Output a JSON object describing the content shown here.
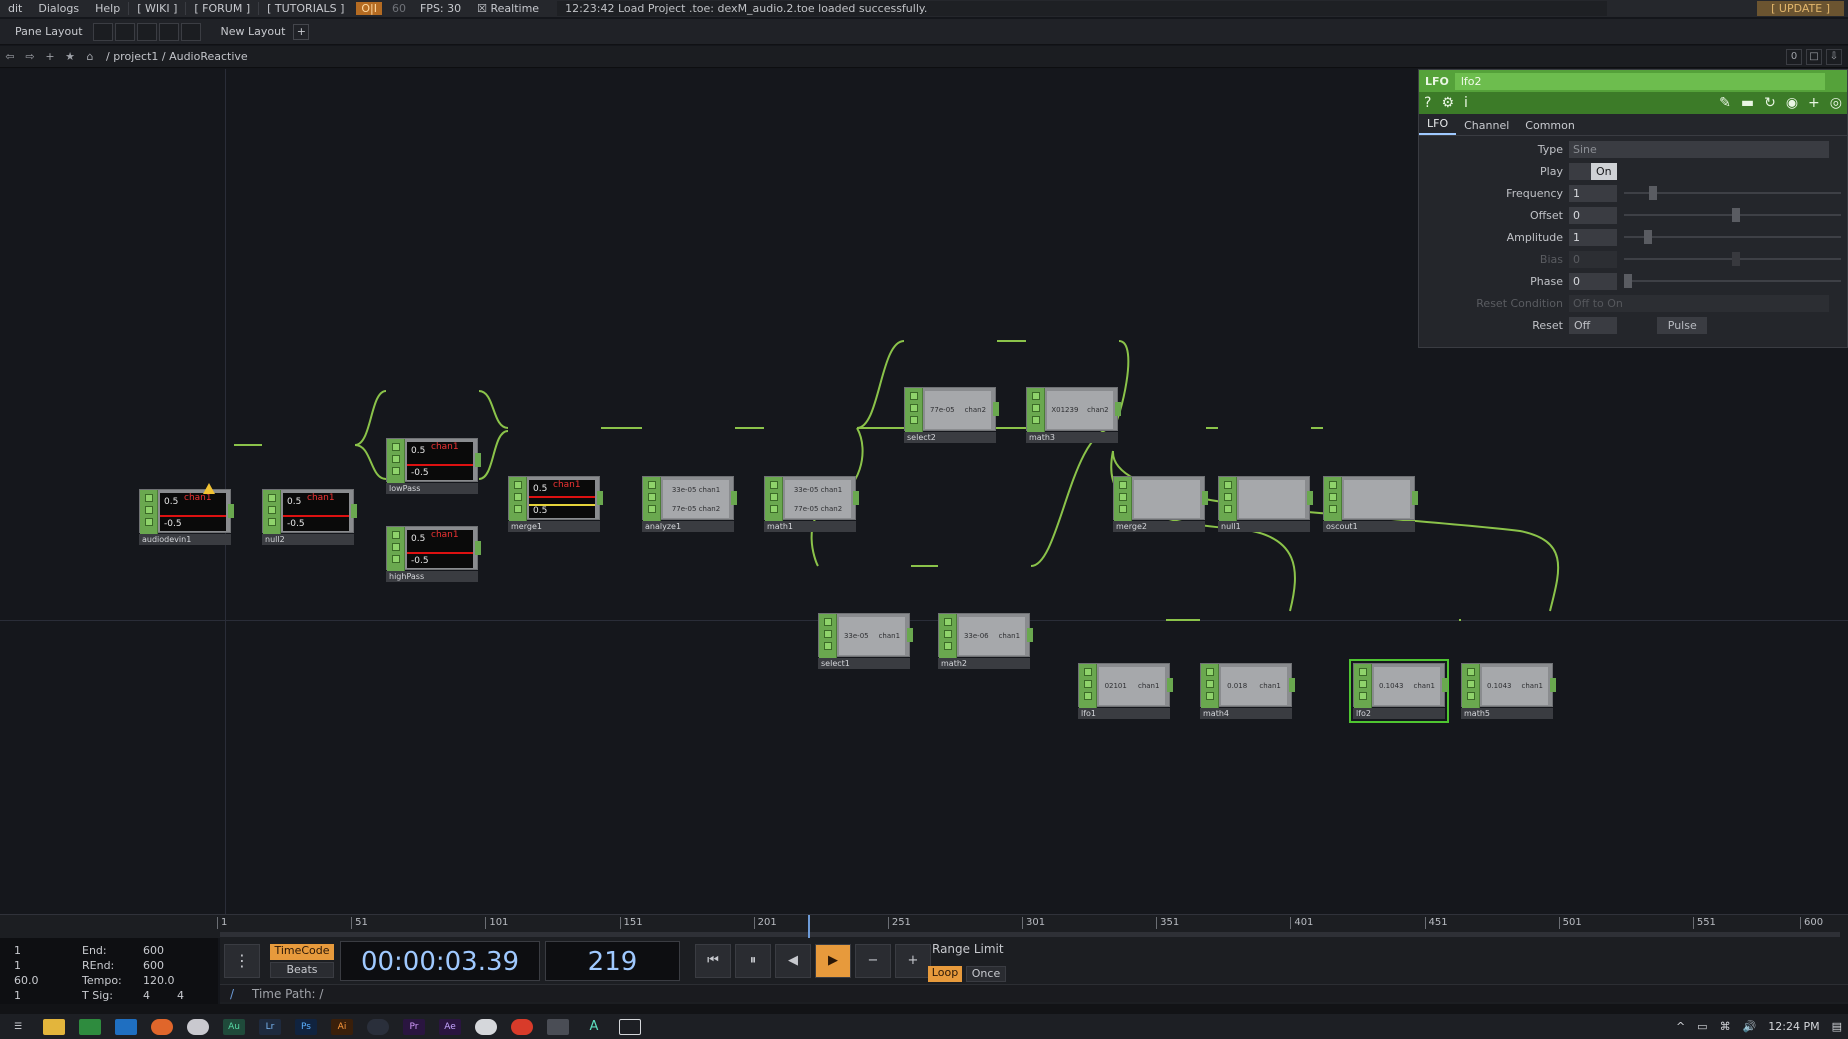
{
  "menubar": {
    "items": [
      "dit",
      "Dialogs",
      "Help"
    ],
    "tabs": [
      "[ WIKI ]",
      "[ FORUM ]",
      "[ TUTORIALS ]"
    ],
    "oi": "O|I",
    "fps_cap": "60",
    "fps": "FPS:  30",
    "realtime": "Realtime",
    "status": "12:23:42 Load Project .toe: dexM_audio.2.toe loaded successfully.",
    "update": "[ UPDATE ]"
  },
  "panebar": {
    "label": "Pane Layout",
    "new_layout": "New Layout",
    "plus": "+"
  },
  "pathbar": {
    "path": "/ project1 / AudioReactive",
    "right": [
      "0",
      "□",
      "⇩"
    ]
  },
  "nodes": [
    {
      "id": "audiodevin1",
      "label": "audiodevin1",
      "kind": "dark",
      "text": "0.5",
      "chan": "chan1",
      "neg": "-0.5"
    },
    {
      "id": "null2",
      "label": "null2",
      "kind": "dark",
      "text": "0.5",
      "chan": "chan1",
      "neg": "-0.5"
    },
    {
      "id": "lowPass",
      "label": "lowPass",
      "kind": "dark",
      "text": "0.5",
      "chan": "chan1",
      "neg": "-0.5"
    },
    {
      "id": "highPass",
      "label": "highPass",
      "kind": "dark",
      "text": "0.5",
      "chan": "chan1",
      "neg": "-0.5"
    },
    {
      "id": "merge1",
      "label": "merge1",
      "kind": "dark",
      "text": "0.5",
      "chan": "chan1",
      "neg": "0.5"
    },
    {
      "id": "analyze1",
      "label": "analyze1",
      "kind": "light",
      "v1": "33e-05",
      "c1": "chan1",
      "v2": "77e-05",
      "c2": "chan2"
    },
    {
      "id": "math1",
      "label": "math1",
      "kind": "light",
      "v1": "33e-05",
      "c1": "chan1",
      "v2": "77e-05",
      "c2": "chan2"
    },
    {
      "id": "select2",
      "label": "select2",
      "kind": "light",
      "v1": "77e-05",
      "c1": "chan2"
    },
    {
      "id": "math3",
      "label": "math3",
      "kind": "light",
      "v1": "X01239",
      "c1": "chan2"
    },
    {
      "id": "merge2",
      "label": "merge2",
      "kind": "light",
      "v1": "",
      "c1": ""
    },
    {
      "id": "null1",
      "label": "null1",
      "kind": "light",
      "v1": "",
      "c1": ""
    },
    {
      "id": "oscout1",
      "label": "oscout1",
      "kind": "light",
      "v1": "",
      "c1": ""
    },
    {
      "id": "select1",
      "label": "select1",
      "kind": "light",
      "v1": "33e-05",
      "c1": "chan1"
    },
    {
      "id": "math2",
      "label": "math2",
      "kind": "light",
      "v1": "33e-06",
      "c1": "chan1"
    },
    {
      "id": "lfo1",
      "label": "lfo1",
      "kind": "light",
      "v1": "02101",
      "c1": "chan1"
    },
    {
      "id": "math4",
      "label": "math4",
      "kind": "light",
      "v1": "0.018",
      "c1": "chan1"
    },
    {
      "id": "lfo2",
      "label": "lfo2",
      "kind": "light",
      "v1": "0.1043",
      "c1": "chan1"
    },
    {
      "id": "math5",
      "label": "math5",
      "kind": "light",
      "v1": "0.1043",
      "c1": "chan1"
    }
  ],
  "params": {
    "op_type": "LFO",
    "op_name": "lfo2",
    "tabs": [
      "LFO",
      "Channel",
      "Common"
    ],
    "type_label": "Type",
    "type_value": "Sine",
    "play_label": "Play",
    "play_value": "On",
    "frequency_label": "Frequency",
    "frequency_value": "1",
    "offset_label": "Offset",
    "offset_value": "0",
    "amplitude_label": "Amplitude",
    "amplitude_value": "1",
    "bias_label": "Bias",
    "bias_value": "0",
    "phase_label": "Phase",
    "phase_value": "0",
    "reset_condition_label": "Reset Condition",
    "reset_condition_value": "Off to On",
    "reset_label": "Reset",
    "reset_value": "Off",
    "pulse_label": "Pulse"
  },
  "timeline": {
    "ticks": [
      "1",
      "51",
      "101",
      "151",
      "201",
      "251",
      "301",
      "351",
      "401",
      "451",
      "501",
      "551",
      "600"
    ],
    "current_frame_fraction": 0.365
  },
  "info": {
    "left_col": [
      "1",
      "1",
      "60.0",
      "1"
    ],
    "labels": [
      "End:",
      "REnd:",
      "Tempo:",
      "T Sig:"
    ],
    "values": [
      "600",
      "600",
      "120.0",
      "4"
    ],
    "tsig_extra": "4"
  },
  "controls": {
    "timecode_label": "TimeCode",
    "beats_label": "Beats",
    "clock": "00:00:03.39",
    "frame": "219",
    "range_limit": "Range Limit",
    "loop": "Loop",
    "once": "Once",
    "time_path_label": "Time Path: /",
    "path_slash": "/"
  },
  "taskbar": {
    "time": "12:24 PM"
  },
  "colors": {
    "accent": "#e79a3c",
    "chop_green": "#6aa84f",
    "selected": "#4fc531",
    "timecode_blue": "#9fc9ff"
  }
}
